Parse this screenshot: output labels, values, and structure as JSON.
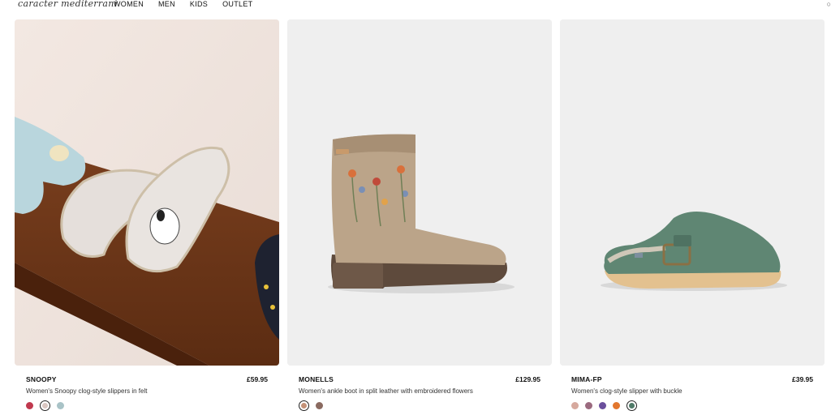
{
  "header": {
    "logo_text": "caracter mediterrani",
    "nav": [
      "WOMEN",
      "MEN",
      "KIDS",
      "OUTLET"
    ]
  },
  "products": [
    {
      "name": "SNOOPY",
      "price": "£59.95",
      "description": "Women's Snoopy clog-style slippers in felt",
      "swatches": [
        "#c0394e",
        "#d9c6c1",
        "#a9c3c7"
      ],
      "selected_swatch": 1
    },
    {
      "name": "MONELLS",
      "price": "£129.95",
      "description": "Women's ankle boot in split leather with embroidered flowers",
      "swatches": [
        "#c49278",
        "#8a6a60"
      ],
      "selected_swatch": 0
    },
    {
      "name": "MIMA-FP",
      "price": "£39.95",
      "description": "Women's clog-style slipper with buckle",
      "swatches": [
        "#d6a99e",
        "#9b6a7f",
        "#6a4f9c",
        "#e2762e",
        "#4f7a68"
      ],
      "selected_swatch": 4
    }
  ]
}
